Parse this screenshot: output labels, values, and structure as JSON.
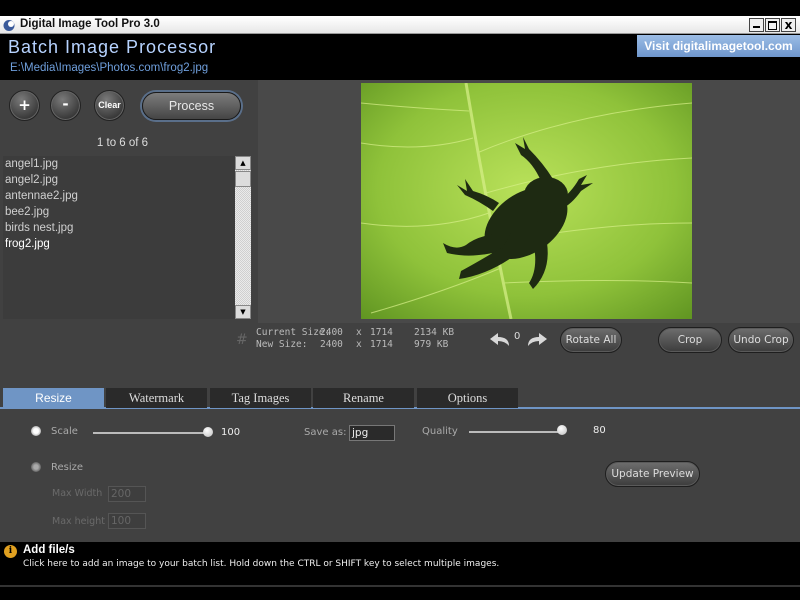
{
  "window": {
    "title": "Digital Image Tool Pro 3.0",
    "close_glyph": "x"
  },
  "header": {
    "app_title": "Batch Image Processor",
    "file_path": "E:\\Media\\Images\\Photos.com\\frog2.jpg",
    "visit_link": "Visit digitalimagetool.com"
  },
  "toolbar": {
    "add_label": "+",
    "remove_label": "-",
    "clear_label": "Clear",
    "process_label": "Process"
  },
  "filelist": {
    "count_text": "1 to 6 of 6",
    "items": [
      "angel1.jpg",
      "angel2.jpg",
      "antennae2.jpg",
      "bee2.jpg",
      "birds nest.jpg",
      "frog2.jpg"
    ],
    "selected": "frog2.jpg"
  },
  "size_info": {
    "current_label": "Current Size:",
    "current_w": "2400",
    "current_x": "x",
    "current_h": "1714",
    "current_kb": "2134 KB",
    "new_label": "New Size:",
    "new_w": "2400",
    "new_x": "x",
    "new_h": "1714",
    "new_kb": "979 KB"
  },
  "rotation": {
    "count": "0"
  },
  "actions": {
    "rotate_all": "Rotate All",
    "crop": "Crop",
    "undo_crop": "Undo Crop"
  },
  "tabs": [
    "Resize",
    "Watermark",
    "Tag Images",
    "Rename",
    "Options"
  ],
  "active_tab": "Resize",
  "resize": {
    "scale_label": "Scale",
    "scale_value": "100",
    "save_as_label": "Save as:",
    "save_as_value": "jpg",
    "quality_label": "Quality",
    "quality_value": "80",
    "resize_label": "Resize",
    "max_width_label": "Max Width",
    "max_width_value": "200",
    "max_height_label": "Max height",
    "max_height_value": "100",
    "update_preview": "Update Preview"
  },
  "status": {
    "title": "Add file/s",
    "text": "Click here to add an image to your batch list. Hold down the CTRL or SHIFT key to select multiple images."
  },
  "colors": {
    "accent": "#6f95c5",
    "panel": "#414141",
    "leaf_green": "#8fc23a"
  },
  "icons": [
    "app-logo-icon",
    "minimize-icon",
    "maximize-icon",
    "close-icon",
    "hash-icon",
    "undo-rotate-icon",
    "redo-rotate-icon",
    "info-icon"
  ]
}
